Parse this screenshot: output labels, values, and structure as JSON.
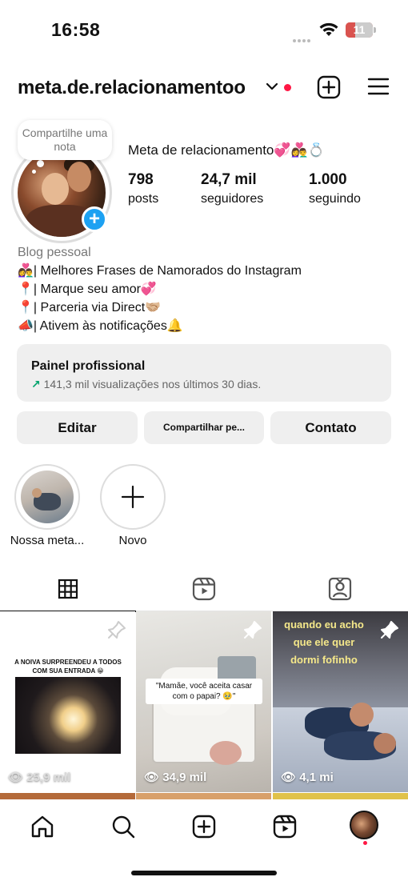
{
  "status_bar": {
    "time": "16:58",
    "battery": "11"
  },
  "header": {
    "username": "meta.de.relacionamentoo"
  },
  "note": {
    "text": "Compartilhe uma nota"
  },
  "profile": {
    "display_name": "Meta de relacionamento💞👩‍❤️‍👨💍",
    "stats": [
      {
        "value": "798",
        "label": "posts"
      },
      {
        "value": "24,7 mil",
        "label": "seguidores"
      },
      {
        "value": "1.000",
        "label": "seguindo"
      }
    ],
    "category": "Blog pessoal",
    "bio_lines": [
      "👩‍❤️‍👨| Melhores Frases de Namorados do Instagram",
      "📍| Marque seu amor💞",
      "📍| Parceria via Direct🤝🏼",
      "📣| Ativem às notificações🔔"
    ]
  },
  "dashboard": {
    "title": "Painel profissional",
    "subtitle": "141,3 mil visualizações nos últimos 30 dias."
  },
  "buttons": {
    "edit": "Editar",
    "share": "Compartilhar pe...",
    "contact": "Contato"
  },
  "highlights": [
    {
      "label": "Nossa meta..."
    },
    {
      "label": "Novo"
    }
  ],
  "tabs": [
    "posts-grid",
    "reels",
    "tagged"
  ],
  "grid": [
    {
      "caption": "A NOIVA SURPREENDEU A TODOS COM SUA ENTRADA 😁",
      "views": "25,9 mil"
    },
    {
      "caption": "\"Mamãe, você aceita casar com o papai? 🥹\"",
      "views": "34,9 mil"
    },
    {
      "caption": "quando eu acho que ele quer dormi fofinho",
      "views": "4,1 mi"
    }
  ],
  "icons": {
    "chevron": "chevron-down-icon",
    "create": "plus-square-icon",
    "menu": "hamburger-menu-icon",
    "home": "home-icon",
    "search": "search-icon",
    "reels": "reels-icon"
  },
  "colors": {
    "accent": "#1da1f2",
    "notification": "#ff1744",
    "trend": "#00a36c"
  }
}
